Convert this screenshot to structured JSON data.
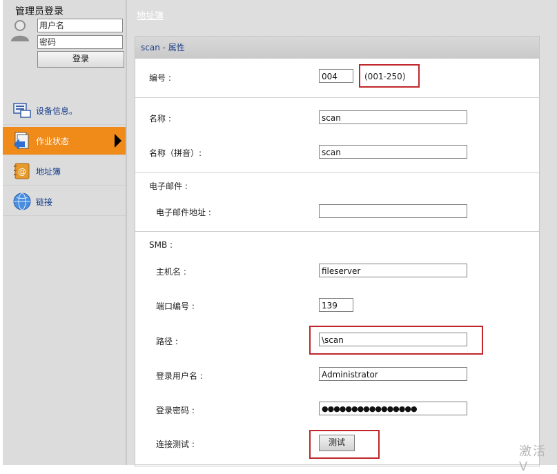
{
  "sidebar": {
    "login_title": "管理员登录",
    "username_placeholder": "用户名",
    "password_placeholder": "密码",
    "login_button": "登录",
    "nav": [
      {
        "label": "设备信息。",
        "icon": "device-info-icon"
      },
      {
        "label": "作业状态",
        "icon": "job-status-icon",
        "active": true
      },
      {
        "label": "地址簿",
        "icon": "address-book-icon"
      },
      {
        "label": "链接",
        "icon": "globe-icon"
      }
    ]
  },
  "main": {
    "breadcrumb": "地址簿",
    "panel_title": "scan - 属性",
    "number": {
      "label": "编号 :",
      "value": "004",
      "range": "(001-250)"
    },
    "name": {
      "label": "名称 :",
      "value": "scan"
    },
    "name_pinyin": {
      "label": "名称（拼音）:",
      "value": "scan"
    },
    "email_section": "电子邮件 :",
    "email_address": {
      "label": "电子邮件地址 :",
      "value": ""
    },
    "smb_section": "SMB :",
    "host": {
      "label": "主机名 :",
      "value": "fileserver"
    },
    "port": {
      "label": "端口编号 :",
      "value": "139"
    },
    "path": {
      "label": "路径 :",
      "value": "\\scan"
    },
    "login_user": {
      "label": "登录用户名 :",
      "value": "Administrator"
    },
    "login_password": {
      "label": "登录密码 :",
      "value": "●●●●●●●●●●●●●●●●"
    },
    "connection_test": {
      "label": "连接测试 :",
      "button": "测试"
    }
  },
  "watermark": "激活 V",
  "colors": {
    "active_nav": "#f08a18",
    "highlight": "#c0252b",
    "header_text": "#1e3f88"
  }
}
